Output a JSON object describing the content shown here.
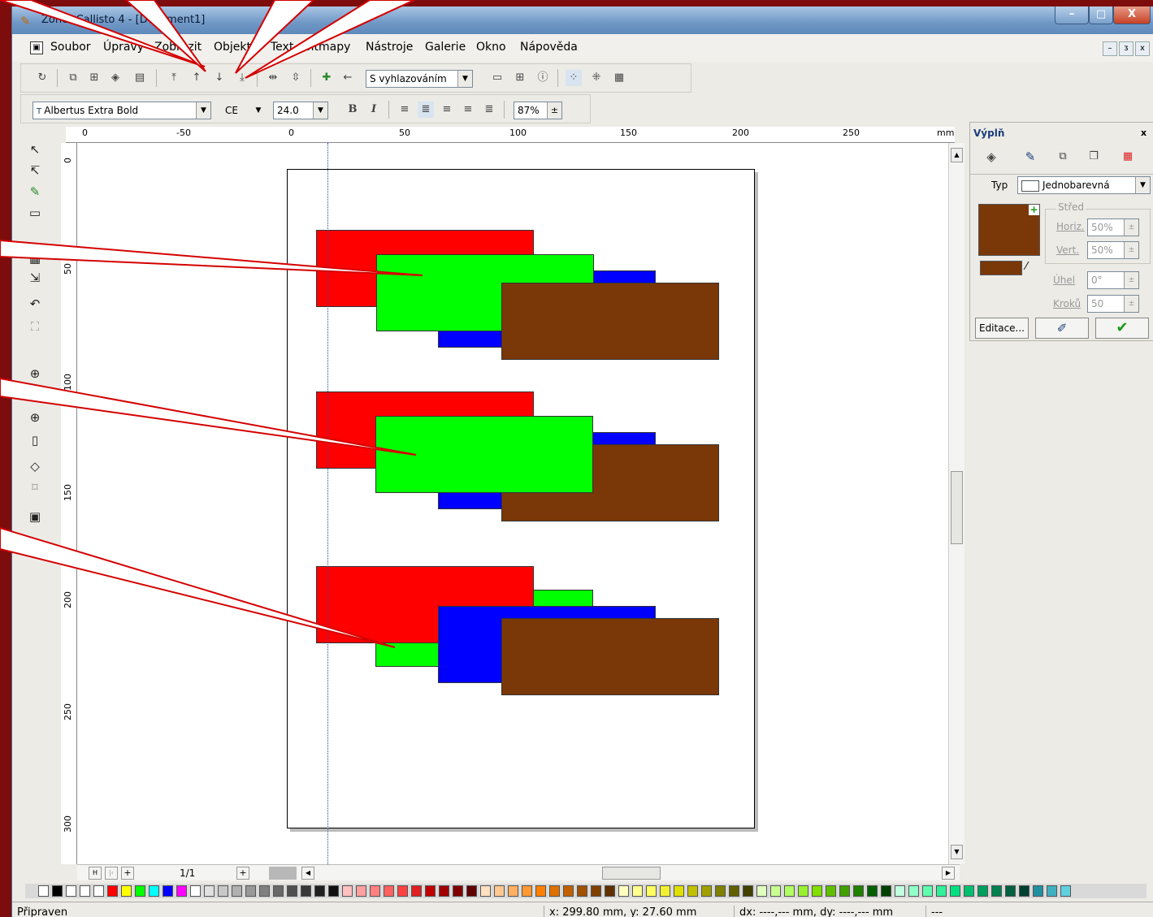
{
  "window": {
    "title": "Zoner Callisto 4 - [Dokument1]",
    "minimize": "–",
    "maximize": "□",
    "close": "X"
  },
  "menu": [
    "Soubor",
    "Úpravy",
    "Zobrazit",
    "Objekt",
    "Text",
    "Bitmapy",
    "Nástroje",
    "Galerie",
    "Okno",
    "Nápověda"
  ],
  "mdi_controls": [
    "–",
    "ᴣ",
    "x"
  ],
  "toolbar1": {
    "smoothing_value": "S vyhlazováním"
  },
  "toolbar2": {
    "font": "Albertus Extra Bold",
    "charset": "CE",
    "size": "24.0",
    "bold": "B",
    "italic": "I",
    "zoom": "87%"
  },
  "ruler_h": [
    "0",
    "-50",
    "0",
    "50",
    "100",
    "150",
    "200",
    "250",
    "mm"
  ],
  "ruler_v": [
    "0",
    "50",
    "100",
    "150",
    "200",
    "250",
    "300"
  ],
  "shapes": {
    "colors": {
      "red": "#ff0000",
      "green": "#00ff00",
      "blue": "#0000ff",
      "brown": "#7a3808"
    }
  },
  "pagenav": {
    "first": "H",
    "prev": "|‹",
    "add": "+",
    "pages": "1/1",
    "add2": "+"
  },
  "dock": {
    "title": "Výplň",
    "close": "x",
    "type_label": "Typ",
    "type_value": "Jednobarevná",
    "center_label": "Střed",
    "horiz_label": "Horiz.",
    "horiz_value": "50%",
    "vert_label": "Vert.",
    "vert_value": "50%",
    "angle_label": "Úhel",
    "angle_value": "0°",
    "steps_label": "Kroků",
    "steps_value": "50",
    "edit_button": "Editace...",
    "fill_color": "#7a3808"
  },
  "status": {
    "text": "Připraven",
    "coords": "x: 299.80 mm, y: 27.60 mm",
    "delta": "dx: ----,--- mm, dy: ----,--- mm",
    "extra": "---"
  }
}
